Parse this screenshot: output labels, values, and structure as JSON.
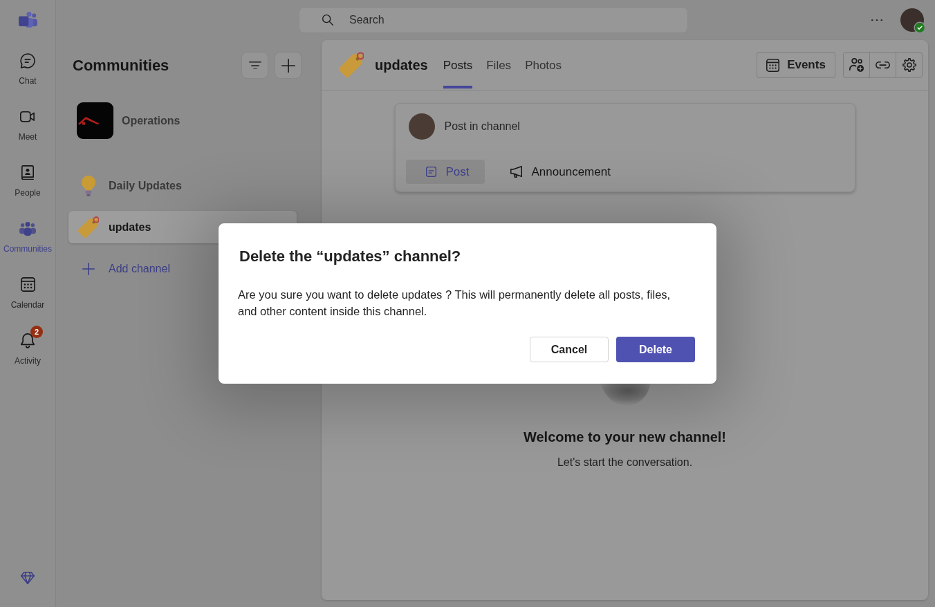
{
  "rail": {
    "items": [
      {
        "label": "Chat",
        "selected": false
      },
      {
        "label": "Meet",
        "selected": false
      },
      {
        "label": "People",
        "selected": false
      },
      {
        "label": "Communities",
        "selected": true
      },
      {
        "label": "Calendar",
        "selected": false
      },
      {
        "label": "Activity",
        "selected": false,
        "badge": "2"
      }
    ]
  },
  "top_bar": {
    "search": {
      "placeholder": "Search"
    },
    "user": {
      "available": true
    }
  },
  "sidebar": {
    "title": "Communities",
    "community": {
      "name": "Operations"
    },
    "channels": [
      {
        "name": "Daily Updates",
        "selected": false
      },
      {
        "name": "updates",
        "selected": true
      }
    ],
    "add_channel": "Add channel"
  },
  "channel": {
    "name": "updates",
    "tabs": [
      {
        "label": "Posts",
        "selected": true
      },
      {
        "label": "Files",
        "selected": false
      },
      {
        "label": "Photos",
        "selected": false
      }
    ],
    "actions": {
      "events": "Events"
    },
    "composer": {
      "prompt": "Post in channel",
      "types": [
        {
          "label": "Post",
          "selected": true
        },
        {
          "label": "Announcement",
          "selected": false
        }
      ]
    },
    "welcome": {
      "title": "Welcome to your new channel!",
      "subtitle": "Let's start the conversation."
    }
  },
  "dialog": {
    "title": "Delete the “updates” channel?",
    "message": "Are you sure you want to delete updates ? This will permanently delete all posts, files, and other content inside this channel.",
    "buttons": [
      {
        "label": "Cancel",
        "kind": "secondary"
      },
      {
        "label": "Delete",
        "kind": "primary"
      }
    ]
  }
}
